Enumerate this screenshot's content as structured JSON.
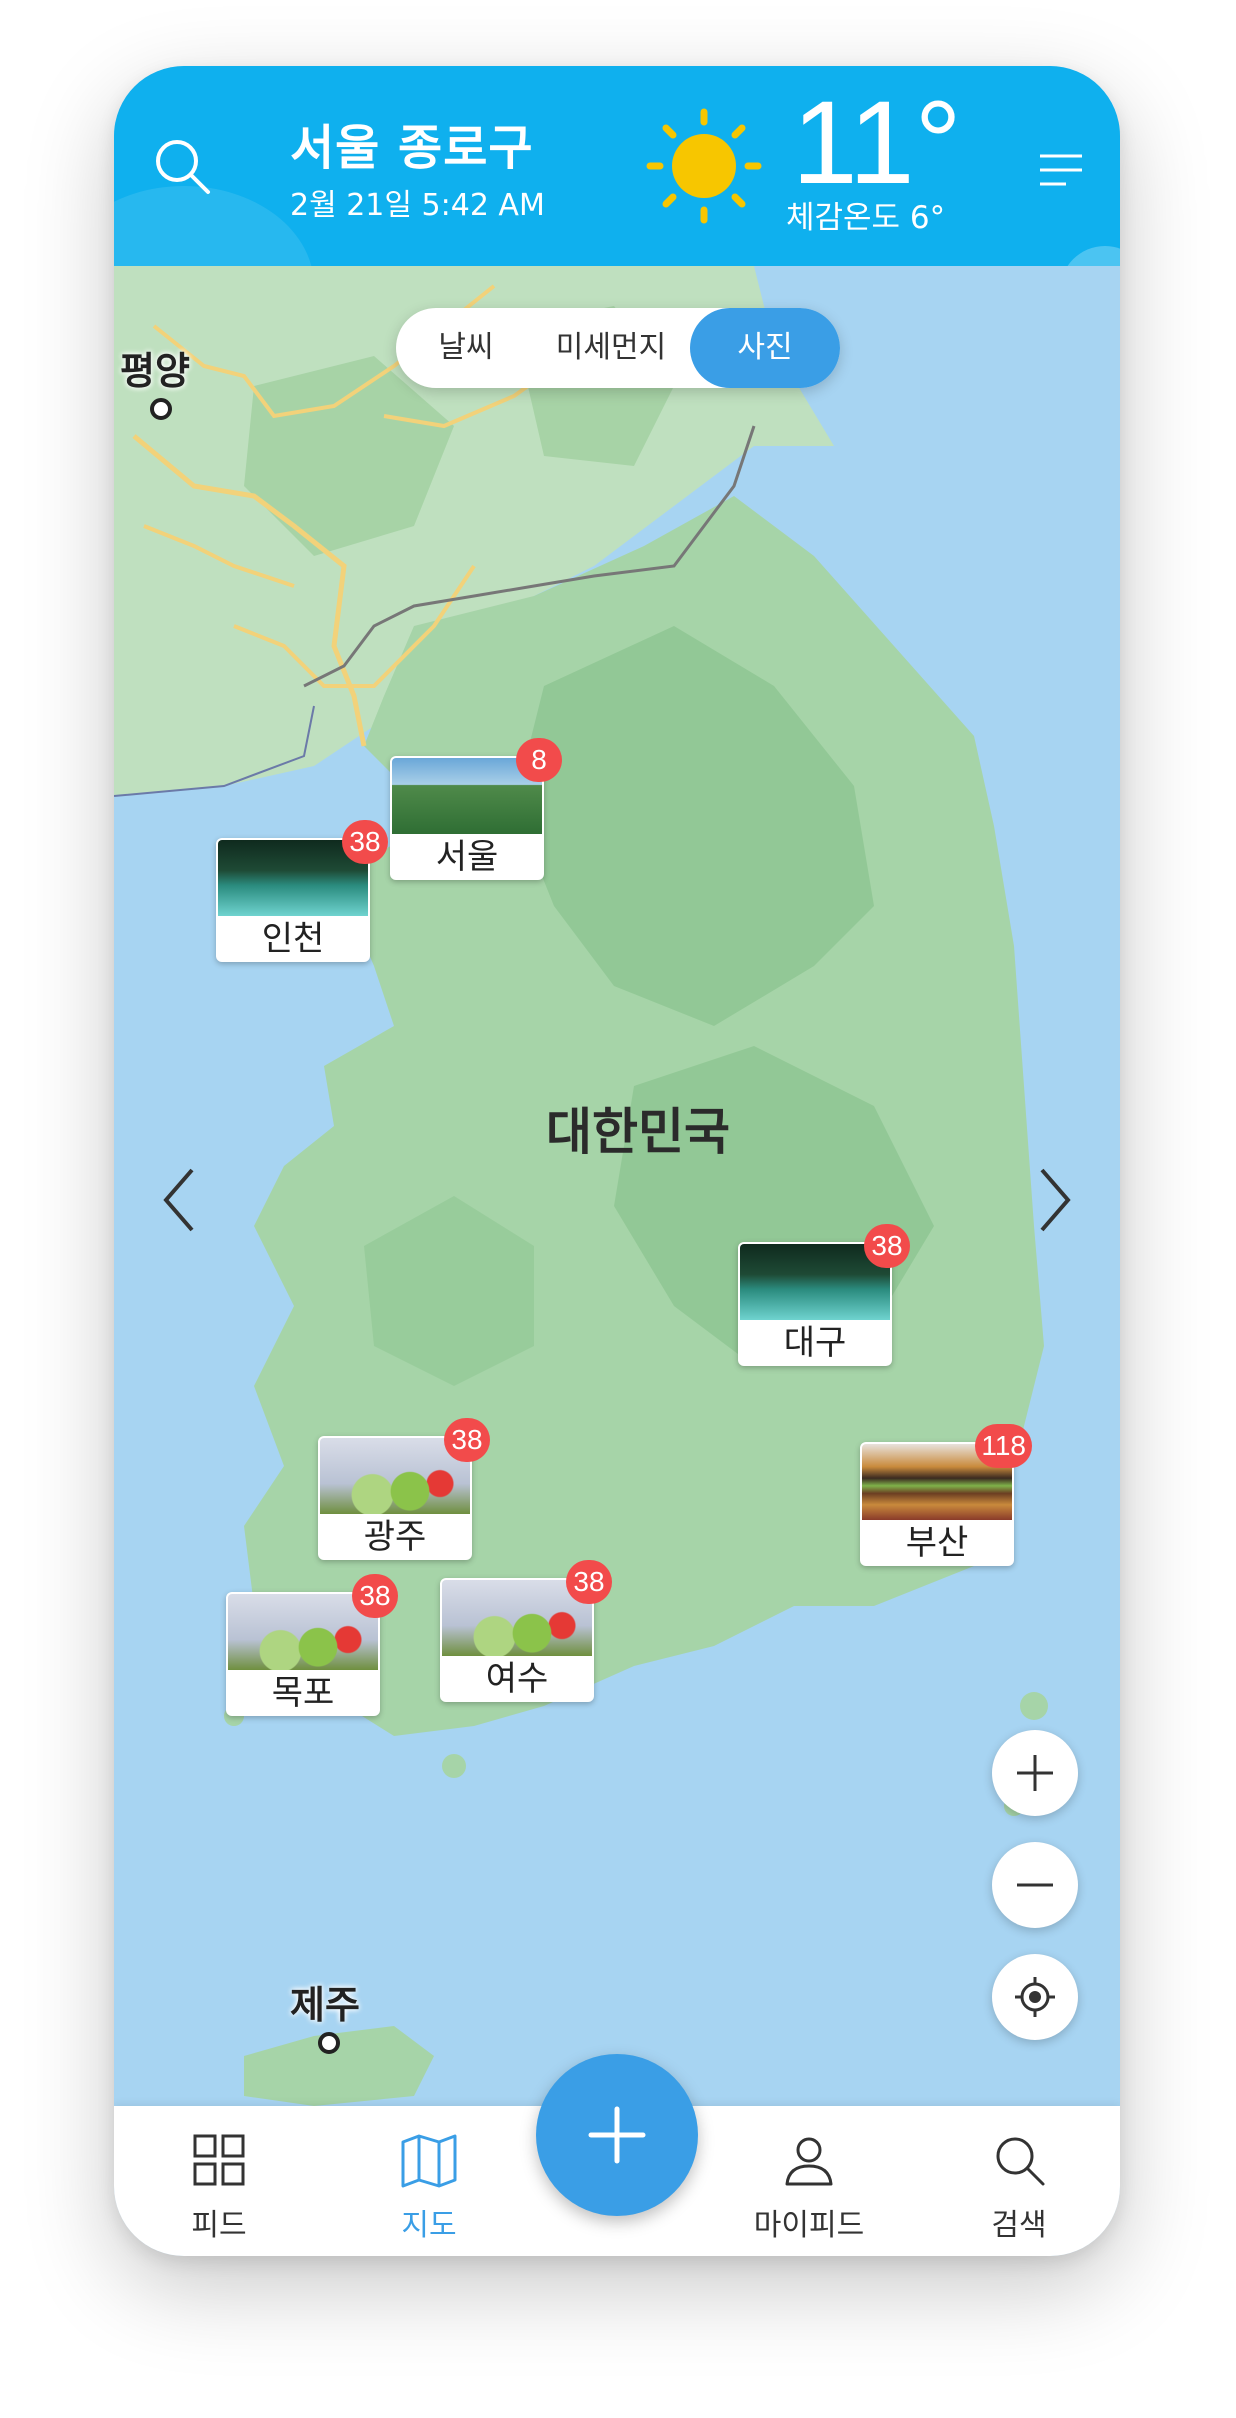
{
  "header": {
    "location": "서울 종로구",
    "datetime": "2월 21일 5:42 AM",
    "temperature": "11°",
    "feels_like": "체감온도 6°",
    "weather_icon": "sun-icon"
  },
  "tabs": [
    {
      "label": "날씨",
      "active": false
    },
    {
      "label": "미세먼지",
      "active": false
    },
    {
      "label": "사진",
      "active": true
    }
  ],
  "map": {
    "country_label": "대한민국",
    "city_labels": [
      "평양",
      "제주"
    ],
    "markers": [
      {
        "name": "서울",
        "count": "8",
        "photo": "mountain"
      },
      {
        "name": "인천",
        "count": "38",
        "photo": "water"
      },
      {
        "name": "대구",
        "count": "38",
        "photo": "water"
      },
      {
        "name": "광주",
        "count": "38",
        "photo": "salad"
      },
      {
        "name": "부산",
        "count": "118",
        "photo": "burger"
      },
      {
        "name": "목포",
        "count": "38",
        "photo": "salad"
      },
      {
        "name": "여수",
        "count": "38",
        "photo": "salad"
      }
    ]
  },
  "controls": [
    "zoom-in-icon",
    "zoom-out-icon",
    "locate-icon"
  ],
  "bottom_nav": [
    {
      "label": "피드",
      "icon": "grid-icon",
      "active": false
    },
    {
      "label": "지도",
      "icon": "map-icon",
      "active": true
    },
    {
      "label": "마이피드",
      "icon": "user-icon",
      "active": false
    },
    {
      "label": "검색",
      "icon": "search-icon",
      "active": false
    }
  ],
  "colors": {
    "header_bg": "#0fb0ee",
    "accent": "#3a9ee6",
    "badge": "#f24b4b",
    "sea": "#a7d4f2",
    "land": "#a3d3a6"
  }
}
